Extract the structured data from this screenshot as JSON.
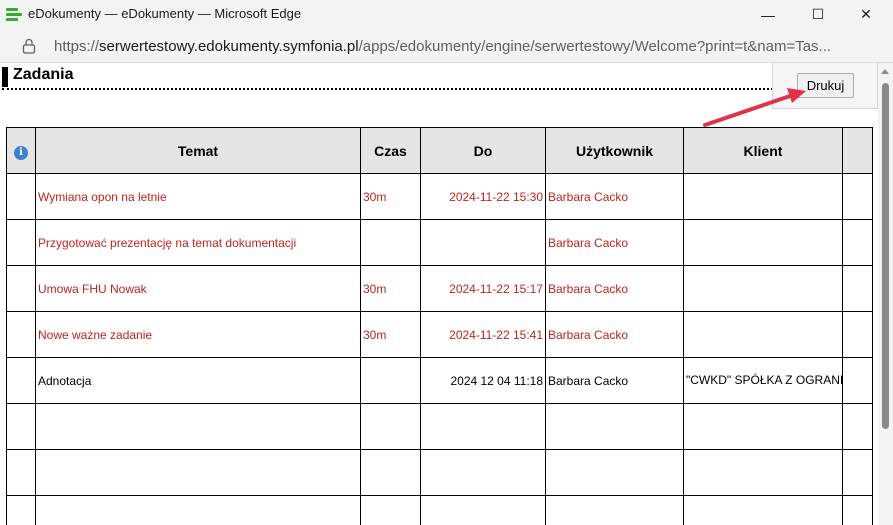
{
  "window": {
    "title": "eDokumenty — eDokumenty — Microsoft Edge",
    "minimize_glyph": "—",
    "maximize_glyph": "☐",
    "close_glyph": "✕"
  },
  "address": {
    "prefix": "https://",
    "domain": "serwertestowy.edokumenty.symfonia.pl",
    "path": "/apps/edokumenty/engine/serwertestowy/Welcome?print=t&nam=Tas..."
  },
  "page": {
    "heading": "Zadania",
    "print_label": "Drukuj"
  },
  "table": {
    "info_glyph": "i",
    "headers": [
      "Temat",
      "Czas",
      "Do",
      "Użytkownik",
      "Klient"
    ],
    "rows": [
      {
        "temat": "Wymiana opon na letnie",
        "czas": "30m",
        "do": "2024-11-22 15:30",
        "uzytkownik": "Barbara Cacko",
        "klient": "",
        "status": "red"
      },
      {
        "temat": "Przygotować prezentację na temat dokumentacji",
        "czas": "",
        "do": "",
        "uzytkownik": "Barbara Cacko",
        "klient": "",
        "status": "red"
      },
      {
        "temat": "Umowa FHU Nowak",
        "czas": "30m",
        "do": "2024-11-22 15:17",
        "uzytkownik": "Barbara Cacko",
        "klient": "",
        "status": "red"
      },
      {
        "temat": "Nowe ważne zadanie",
        "czas": "30m",
        "do": "2024-11-22 15:41",
        "uzytkownik": "Barbara Cacko",
        "klient": "",
        "status": "red"
      },
      {
        "temat": "Adnotacja",
        "czas": "",
        "do": "2024 12 04 11:18",
        "uzytkownik": "Barbara Cacko",
        "klient": "\"CWKD\" SPÓŁKA Z OGRANICZONĄ ODPOWIEDZIALNOŚCIĄ",
        "status": "black"
      },
      {
        "temat": "",
        "czas": "",
        "do": "",
        "uzytkownik": "",
        "klient": "",
        "status": "black"
      },
      {
        "temat": "",
        "czas": "",
        "do": "",
        "uzytkownik": "",
        "klient": "",
        "status": "black"
      },
      {
        "temat": "",
        "czas": "",
        "do": "",
        "uzytkownik": "",
        "klient": "",
        "status": "black"
      }
    ]
  },
  "colors": {
    "overdue": "#c0241c",
    "annotation_arrow": "#e0334a",
    "app_icon": "#3aaa35"
  },
  "icons": [
    "app-logo-icon",
    "minimize-icon",
    "maximize-icon",
    "close-icon",
    "lock-icon",
    "info-icon",
    "annotation-arrow"
  ]
}
